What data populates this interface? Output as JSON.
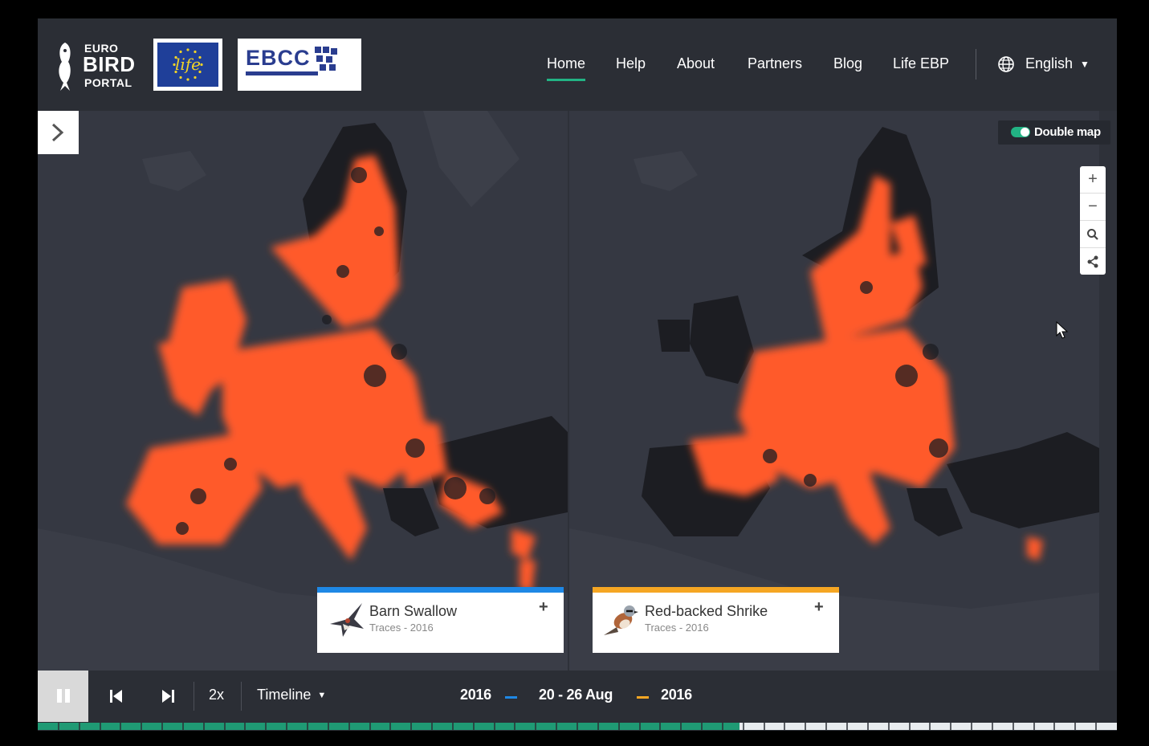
{
  "header": {
    "logo": {
      "line1": "EURO",
      "line2": "BIRD",
      "line3": "PORTAL"
    },
    "life_logo_text": "life",
    "ebcc_logo_text": "EBCC",
    "nav": [
      {
        "label": "Home",
        "active": true
      },
      {
        "label": "Help",
        "active": false
      },
      {
        "label": "About",
        "active": false
      },
      {
        "label": "Partners",
        "active": false
      },
      {
        "label": "Blog",
        "active": false
      },
      {
        "label": "Life EBP",
        "active": false
      }
    ],
    "language": "English"
  },
  "map": {
    "double_map_label": "Double map",
    "double_map_on": true,
    "controls": [
      "zoom-in-icon",
      "zoom-out-icon",
      "magnifier-icon",
      "share-icon"
    ]
  },
  "species": [
    {
      "name": "Barn Swallow",
      "subtitle": "Traces - 2016",
      "color": "#1e88e5"
    },
    {
      "name": "Red-backed Shrike",
      "subtitle": "Traces - 2016",
      "color": "#f5a623"
    }
  ],
  "timeline": {
    "speed": "2x",
    "mode": "Timeline",
    "year_left": "2016",
    "date_range": "20 - 26 Aug",
    "year_right": "2016",
    "progress": 0.65
  },
  "colors": {
    "accent": "#22b384",
    "heat": "#ff5a2a",
    "land": "#1c1d22",
    "sea": "#353842"
  }
}
